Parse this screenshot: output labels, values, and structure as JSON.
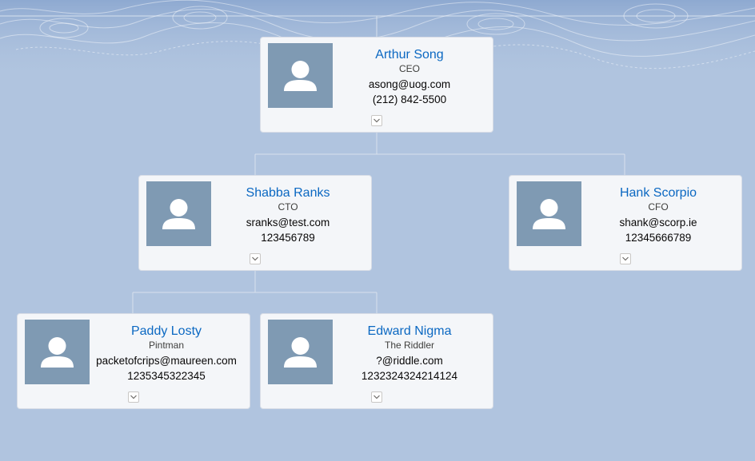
{
  "nodes": [
    {
      "name": "Arthur Song",
      "title": "CEO",
      "email": "asong@uog.com",
      "phone": "(212) 842-5500"
    },
    {
      "name": "Shabba Ranks",
      "title": "CTO",
      "email": "sranks@test.com",
      "phone": "123456789"
    },
    {
      "name": "Hank Scorpio",
      "title": "CFO",
      "email": "shank@scorp.ie",
      "phone": "12345666789"
    },
    {
      "name": "Paddy Losty",
      "title": "Pintman",
      "email": "packetofcrips@maureen.com",
      "phone": "1235345322345"
    },
    {
      "name": "Edward Nigma",
      "title": "The Riddler",
      "email": "?@riddle.com",
      "phone": "1232324324214124"
    }
  ],
  "icons": {
    "avatar": "user-avatar-icon",
    "toggle": "chevron-down-icon"
  },
  "colors": {
    "background": "#b0c4df",
    "card": "#f4f6f9",
    "name": "#0b68c2",
    "avatar_bg": "#7f9ab3"
  }
}
